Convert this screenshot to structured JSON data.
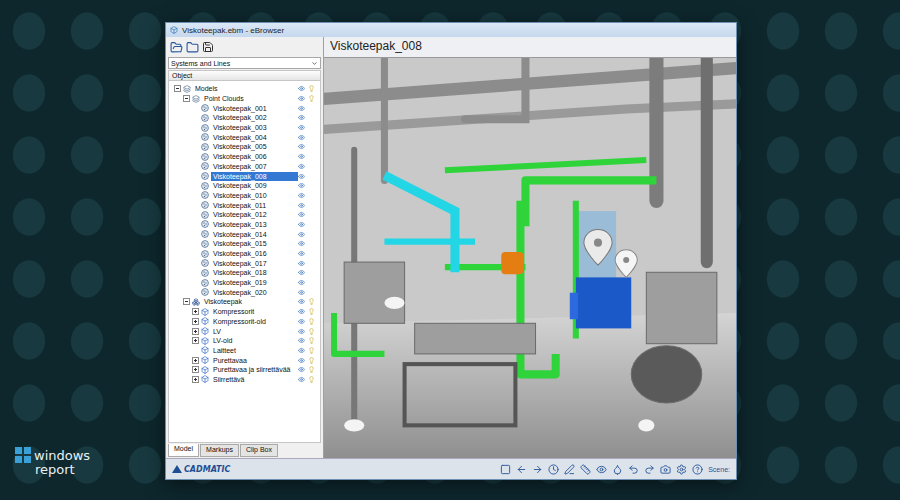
{
  "window": {
    "title": "Viskoteepak.ebm - eBrowser"
  },
  "sidebar": {
    "dropdown": "Systems and Lines",
    "column_header": "Object",
    "items": [
      {
        "label": "Models",
        "kind": "folder",
        "expanded": true,
        "selected": false,
        "children": [
          {
            "label": "Point Clouds",
            "kind": "folder",
            "expanded": true,
            "selected": false,
            "children": [
              {
                "label": "Viskoteepak_001",
                "kind": "pointcloud",
                "expanded": false,
                "selected": false,
                "children": []
              },
              {
                "label": "Viskoteepak_002",
                "kind": "pointcloud",
                "expanded": false,
                "selected": false,
                "children": []
              },
              {
                "label": "Viskoteepak_003",
                "kind": "pointcloud",
                "expanded": false,
                "selected": false,
                "children": []
              },
              {
                "label": "Viskoteepak_004",
                "kind": "pointcloud",
                "expanded": false,
                "selected": false,
                "children": []
              },
              {
                "label": "Viskoteepak_005",
                "kind": "pointcloud",
                "expanded": false,
                "selected": false,
                "children": []
              },
              {
                "label": "Viskoteepak_006",
                "kind": "pointcloud",
                "expanded": false,
                "selected": false,
                "children": []
              },
              {
                "label": "Viskoteepak_007",
                "kind": "pointcloud",
                "expanded": false,
                "selected": false,
                "children": []
              },
              {
                "label": "Viskoteepak_008",
                "kind": "pointcloud",
                "expanded": false,
                "selected": true,
                "children": []
              },
              {
                "label": "Viskoteepak_009",
                "kind": "pointcloud",
                "expanded": false,
                "selected": false,
                "children": []
              },
              {
                "label": "Viskoteepak_010",
                "kind": "pointcloud",
                "expanded": false,
                "selected": false,
                "children": []
              },
              {
                "label": "Viskoteepak_011",
                "kind": "pointcloud",
                "expanded": false,
                "selected": false,
                "children": []
              },
              {
                "label": "Viskoteepak_012",
                "kind": "pointcloud",
                "expanded": false,
                "selected": false,
                "children": []
              },
              {
                "label": "Viskoteepak_013",
                "kind": "pointcloud",
                "expanded": false,
                "selected": false,
                "children": []
              },
              {
                "label": "Viskoteepak_014",
                "kind": "pointcloud",
                "expanded": false,
                "selected": false,
                "children": []
              },
              {
                "label": "Viskoteepak_015",
                "kind": "pointcloud",
                "expanded": false,
                "selected": false,
                "children": []
              },
              {
                "label": "Viskoteepak_016",
                "kind": "pointcloud",
                "expanded": false,
                "selected": false,
                "children": []
              },
              {
                "label": "Viskoteepak_017",
                "kind": "pointcloud",
                "expanded": false,
                "selected": false,
                "children": []
              },
              {
                "label": "Viskoteepak_018",
                "kind": "pointcloud",
                "expanded": false,
                "selected": false,
                "children": []
              },
              {
                "label": "Viskoteepak_019",
                "kind": "pointcloud",
                "expanded": false,
                "selected": false,
                "children": []
              },
              {
                "label": "Viskoteepak_020",
                "kind": "pointcloud",
                "expanded": false,
                "selected": false,
                "children": []
              }
            ]
          },
          {
            "label": "Viskoteepak",
            "kind": "group",
            "expanded": true,
            "selected": false,
            "children": [
              {
                "label": "Kompressorit",
                "kind": "system",
                "expanded": false,
                "selected": false,
                "children": [
                  {
                    "label": "",
                    "kind": "system",
                    "expanded": false,
                    "selected": false,
                    "children": []
                  }
                ]
              },
              {
                "label": "Kompressorit-old",
                "kind": "system",
                "expanded": false,
                "selected": false,
                "children": [
                  {
                    "label": "",
                    "kind": "system",
                    "expanded": false,
                    "selected": false,
                    "children": []
                  }
                ]
              },
              {
                "label": "LV",
                "kind": "system",
                "expanded": false,
                "selected": false,
                "children": [
                  {
                    "label": "",
                    "kind": "system",
                    "expanded": false,
                    "selected": false,
                    "children": []
                  }
                ]
              },
              {
                "label": "LV-old",
                "kind": "system",
                "expanded": false,
                "selected": false,
                "children": [
                  {
                    "label": "",
                    "kind": "system",
                    "expanded": false,
                    "selected": false,
                    "children": []
                  }
                ]
              },
              {
                "label": "Laitteet",
                "kind": "system",
                "expanded": false,
                "selected": false,
                "children": []
              },
              {
                "label": "Purettavaa",
                "kind": "system",
                "expanded": false,
                "selected": false,
                "children": [
                  {
                    "label": "",
                    "kind": "system",
                    "expanded": false,
                    "selected": false,
                    "children": []
                  }
                ]
              },
              {
                "label": "Purettavaa ja siirrettävää",
                "kind": "system",
                "expanded": false,
                "selected": false,
                "children": [
                  {
                    "label": "",
                    "kind": "system",
                    "expanded": false,
                    "selected": false,
                    "children": []
                  }
                ]
              },
              {
                "label": "Siirrettävä",
                "kind": "system",
                "expanded": false,
                "selected": false,
                "children": [
                  {
                    "label": "",
                    "kind": "system",
                    "expanded": false,
                    "selected": false,
                    "children": []
                  }
                ]
              }
            ]
          }
        ]
      }
    ],
    "tabs": [
      {
        "label": "Model",
        "selected": true
      },
      {
        "label": "Markups",
        "selected": false
      },
      {
        "label": "Clip Box",
        "selected": false
      }
    ]
  },
  "view": {
    "title": "Viskoteepak_008"
  },
  "status_bar": {
    "logo": "CADMATIC",
    "scene_label": "Scene:"
  },
  "brand": {
    "line1": "windows",
    "line2": "report"
  }
}
